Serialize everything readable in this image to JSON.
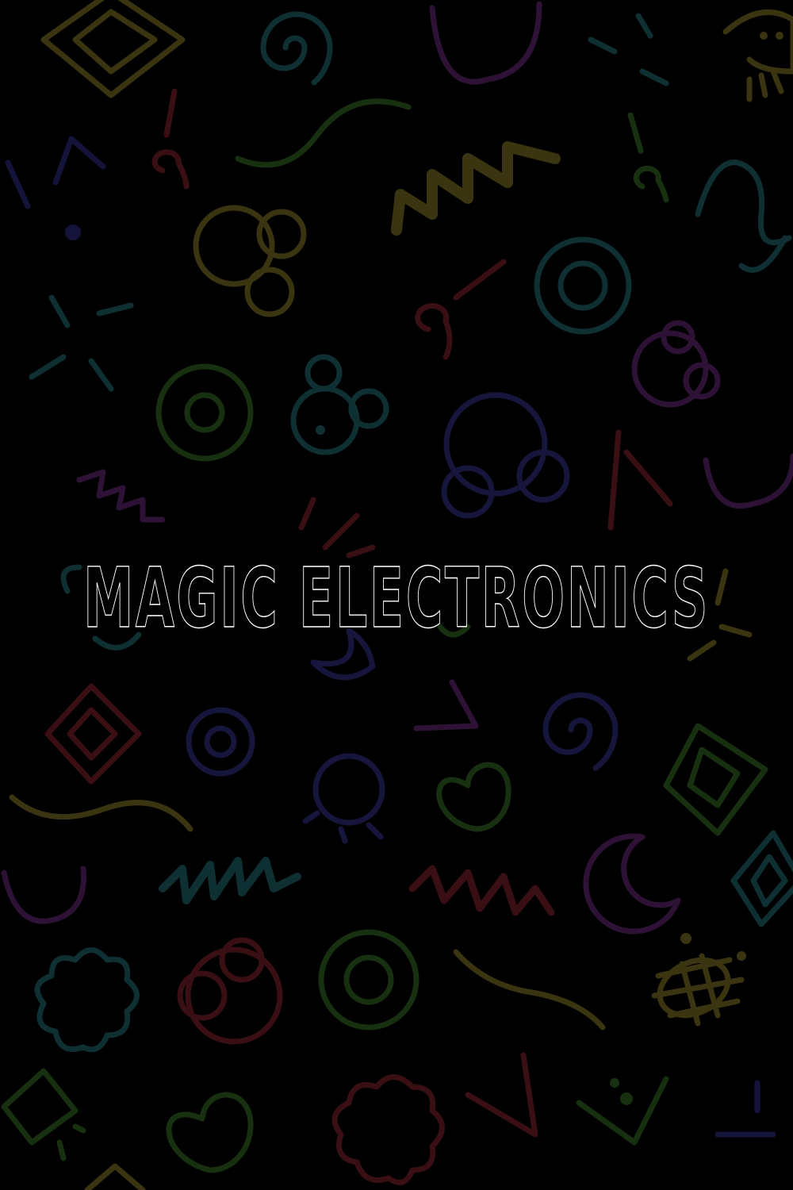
{
  "title": "MAGIC ELECTRONICS",
  "colors": {
    "background": "#000000",
    "title_outline": "#ffffff",
    "pattern_yellow": "#3a3510",
    "pattern_teal": "#0f3033",
    "pattern_purple": "#2d1235",
    "pattern_green": "#17300f",
    "pattern_red": "#3a0f14",
    "pattern_blue": "#16163d"
  },
  "pattern": {
    "icons": [
      "diamond-icon",
      "spiral-icon",
      "zigzag-icon",
      "ring-icon",
      "bubble-cluster-icon",
      "sparkle-icon",
      "wave-icon",
      "heart-icon",
      "flower-icon",
      "crescent-icon",
      "arc-icon",
      "check-mark-icon"
    ]
  }
}
